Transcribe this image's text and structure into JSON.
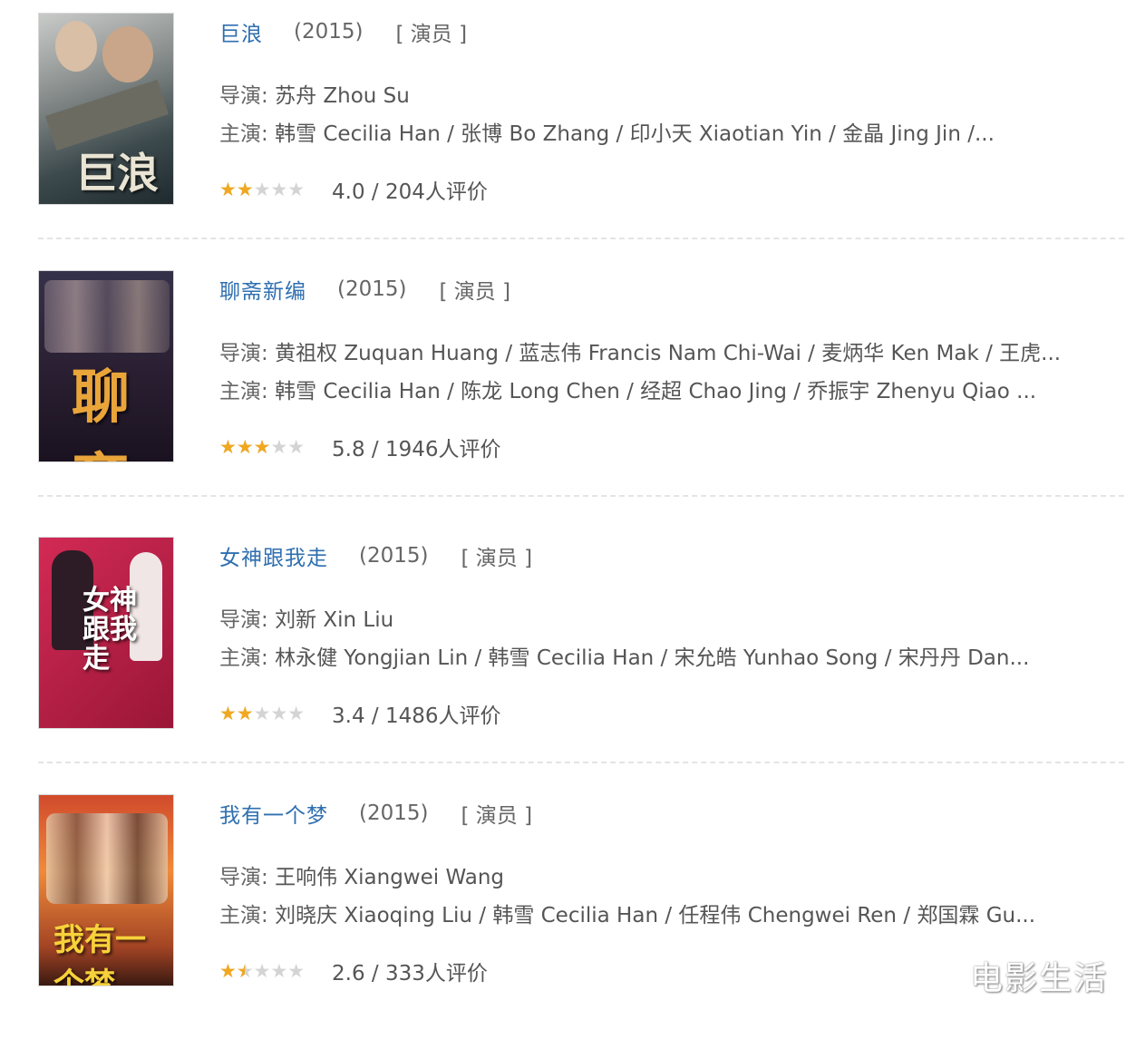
{
  "movies": [
    {
      "title": "巨浪",
      "year": "(2015)",
      "role": "[ 演员 ]",
      "director_label": "导演: ",
      "director": "苏舟 Zhou Su",
      "cast_label": "主演: ",
      "cast": "韩雪 Cecilia Han / 张博 Bo Zhang / 印小天 Xiaotian Yin / 金晶 Jing Jin /...",
      "stars": 2,
      "rating_text": "4.0 / 204人评价",
      "poster_caption": "巨浪",
      "poster_icon": "movie-poster-icon"
    },
    {
      "title": "聊斋新编",
      "year": "(2015)",
      "role": "[ 演员 ]",
      "director_label": "导演: ",
      "director": "黄祖权 Zuquan Huang / 蓝志伟 Francis Nam Chi-Wai / 麦炳华 Ken Mak / 王虎...",
      "cast_label": "主演: ",
      "cast": "韩雪 Cecilia Han / 陈龙 Long Chen / 经超 Chao Jing / 乔振宇 Zhenyu Qiao ...",
      "stars": 3,
      "rating_text": "5.8 / 1946人评价",
      "poster_caption": "聊斋",
      "poster_icon": "movie-poster-icon"
    },
    {
      "title": "女神跟我走",
      "year": "(2015)",
      "role": "[ 演员 ]",
      "director_label": "导演: ",
      "director": "刘新 Xin Liu",
      "cast_label": "主演: ",
      "cast": "林永健 Yongjian Lin / 韩雪 Cecilia Han / 宋允皓 Yunhao Song / 宋丹丹 Dan...",
      "stars": 2,
      "rating_text": "3.4 / 1486人评价",
      "poster_caption": "女神跟我走",
      "poster_icon": "movie-poster-icon"
    },
    {
      "title": "我有一个梦",
      "year": "(2015)",
      "role": "[ 演员 ]",
      "director_label": "导演: ",
      "director": "王响伟 Xiangwei Wang",
      "cast_label": "主演: ",
      "cast": "刘晓庆 Xiaoqing Liu / 韩雪 Cecilia Han / 任程伟 Chengwei Ren / 郑国霖 Gu...",
      "stars": 1.5,
      "rating_text": "2.6 / 333人评价",
      "poster_caption": "我有一个梦",
      "poster_icon": "movie-poster-icon"
    }
  ],
  "star_icon": "star-icon",
  "colors": {
    "link": "#2f6fb0",
    "star": "#f0a820",
    "star_empty": "#d4d4d4"
  },
  "watermark": "电影生活"
}
